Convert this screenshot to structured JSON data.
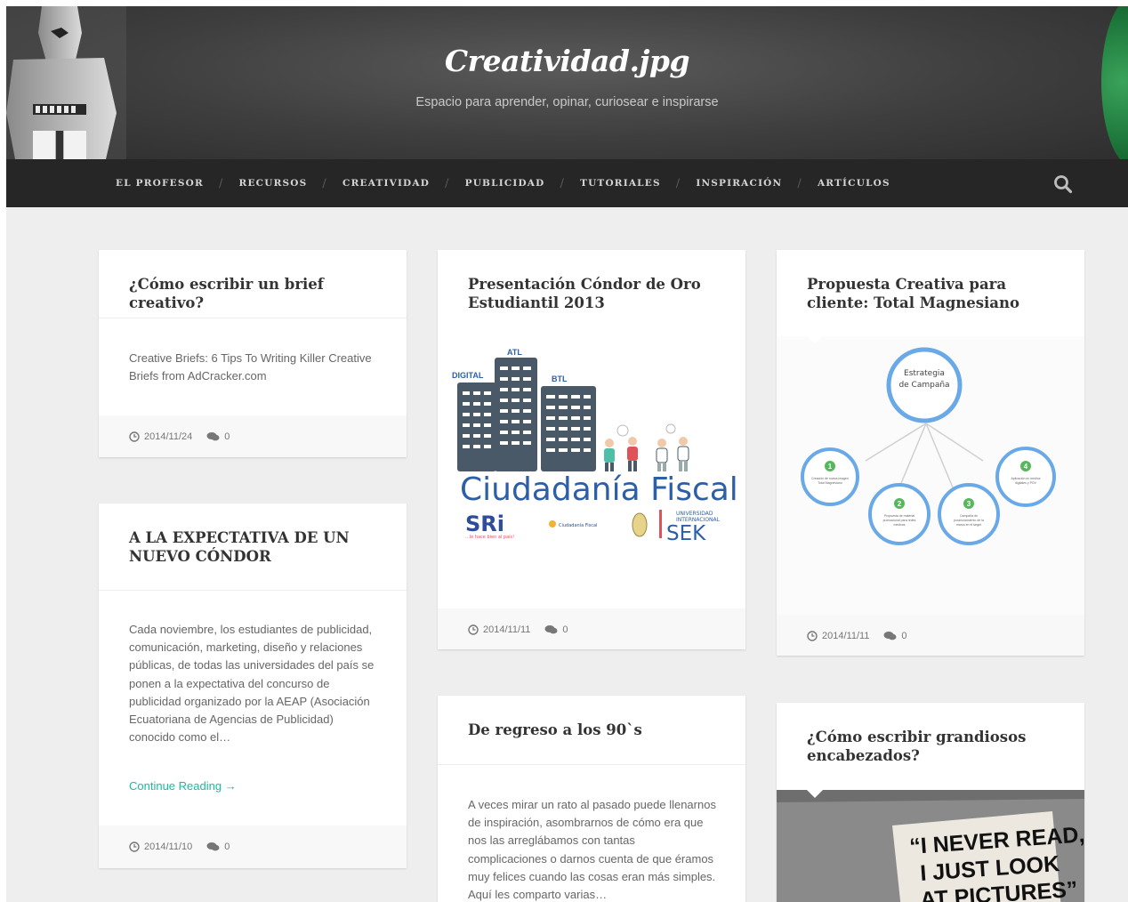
{
  "site": {
    "title": "Creatividad.jpg",
    "description": "Espacio para aprender, opinar, curiosear e inspirarse"
  },
  "nav": {
    "items": [
      "EL PROFESOR",
      "RECURSOS",
      "CREATIVIDAD",
      "PUBLICIDAD",
      "TUTORIALES",
      "INSPIRACIÓN",
      "ARTÍCULOS"
    ],
    "separator": "/"
  },
  "posts": [
    {
      "title": "¿Cómo escribir un brief creativo?",
      "excerpt": "Creative Briefs: 6 Tips To Writing Killer Creative Briefs from AdCracker.com",
      "date": "2014/11/24",
      "comments": "0"
    },
    {
      "title": "A LA EXPECTATIVA DE UN NUEVO CÓNDOR",
      "excerpt": "Cada noviembre, los estudiantes de publicidad, comunicación, marketing, diseño y relaciones públicas, de todas las universidades del país se ponen a la expectativa del concurso de publicidad organizado por la AEAP (Asociación Ecuatoriana de Agencias de Publicidad) conocido como el…",
      "more": "Continue Reading →",
      "date": "2014/11/10",
      "comments": "0"
    },
    {
      "title": "Presentación Cóndor de Oro Estudiantil 2013",
      "image": {
        "labels": [
          "ATL",
          "DIGITAL",
          "BTL"
        ],
        "headline": "Ciudadanía Fiscal",
        "logo_left": "SRi",
        "logo_left_tag": "...le hace bien al país!",
        "logo_mid": "Ciudadanía Fiscal",
        "logo_right_small": [
          "UNIVERSIDAD",
          "INTERNACIONAL"
        ],
        "logo_right": "SEK"
      },
      "date": "2014/11/11",
      "comments": "0"
    },
    {
      "title": "De regreso a los 90`s",
      "excerpt": "A veces mirar un rato al pasado puede llenarnos de inspiración, asombrarnos de cómo era que nos las arreglábamos con tantas complicaciones o darnos cuenta de que éramos muy felices cuando las cosas eran más simples. Aquí les comparto varias…"
    },
    {
      "title": "Propuesta Creativa para cliente: Total Magnesiano",
      "image": {
        "center_label": [
          "Estrategia",
          "de Campaña"
        ],
        "nodes": [
          {
            "num": "1",
            "text": [
              "Creación de nueva imagen",
              "Total Magnesiano"
            ]
          },
          {
            "num": "2",
            "text": [
              "Propuesta de material",
              "promocional para redes",
              "médicas"
            ]
          },
          {
            "num": "3",
            "text": [
              "Campaña de",
              "posicionamiento de la",
              "marca en el target"
            ]
          },
          {
            "num": "4",
            "text": [
              "Aplicación en medios",
              "digitales y POV"
            ]
          }
        ]
      },
      "date": "2014/11/11",
      "comments": "0"
    },
    {
      "title": "¿Cómo escribir grandiosos encabezados?",
      "image": {
        "lines": [
          "“I NEVER READ,",
          "I JUST LOOK",
          "AT PICTURES”"
        ]
      }
    }
  ],
  "colors": {
    "accent": "#1abc9c",
    "nav_bg": "#262626",
    "page_bg": "#eeeeee"
  }
}
